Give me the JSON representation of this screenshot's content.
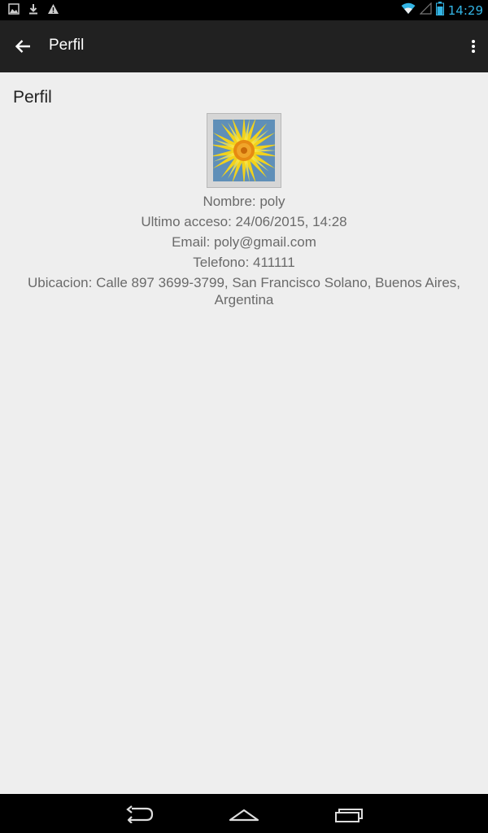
{
  "status_bar": {
    "time": "14:29",
    "left_icons": [
      "image-icon",
      "download-icon",
      "warning-icon"
    ],
    "right_icons": [
      "wifi-icon",
      "signal-icon",
      "battery-icon"
    ],
    "accent_color": "#33b5e5"
  },
  "app_bar": {
    "title": "Perfil",
    "back_icon": "arrow-back-icon",
    "menu_icon": "overflow-menu-icon",
    "background": "#212121"
  },
  "profile": {
    "section_title": "Perfil",
    "avatar_icon": "sunflower-avatar-image",
    "nombre": "Nombre: poly",
    "ultimo_acceso": "Ultimo acceso: 24/06/2015, 14:28",
    "email": "Email: poly@gmail.com",
    "telefono": "Telefono: 411111",
    "ubicacion": "Ubicacion: Calle 897 3699-3799, San Francisco Solano, Buenos Aires, Argentina"
  },
  "nav_bar": {
    "back": "nav-back-icon",
    "home": "nav-home-icon",
    "recents": "nav-recents-icon"
  }
}
